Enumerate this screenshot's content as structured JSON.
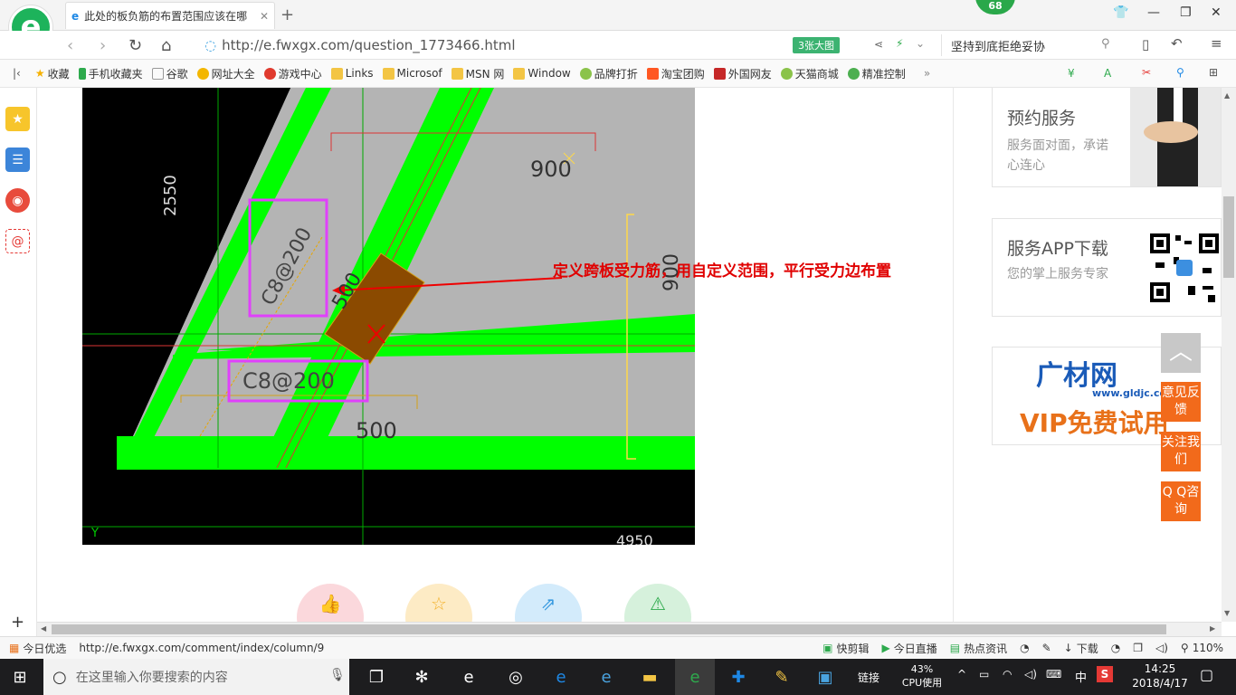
{
  "tab": {
    "title": "此处的板负筋的布置范围应该在哪"
  },
  "badge": "68",
  "address": {
    "url": "http://e.fwxgx.com/question_1773466.html",
    "bigpic": "3张大图"
  },
  "search": {
    "text": "坚持到底拒绝妥协"
  },
  "favorites": [
    "收藏",
    "手机收藏夹",
    "谷歌",
    "网址大全",
    "游戏中心",
    "Links",
    "Microsof",
    "MSN 网",
    "Window",
    "品牌打折",
    "淘宝团购",
    "外国网友",
    "天猫商城",
    "精准控制"
  ],
  "favorites_more": "»",
  "cad": {
    "dims": [
      "2550",
      "900",
      "900",
      "500",
      "500",
      "4950"
    ],
    "labels": [
      "C8@200",
      "C8@200"
    ],
    "axis": "Y"
  },
  "annotation": "定义跨板受力筋，用自定义范围，平行受力边布置",
  "cards": {
    "service": {
      "title": "预约服务",
      "sub": "服务面对面，承诺心连心"
    },
    "app": {
      "title": "服务APP下载",
      "sub": "您的掌上服务专家"
    },
    "ad": {
      "brand": "广材网",
      "url": "www.gldjc.com",
      "vip": "VIP免费试用"
    }
  },
  "float_buttons": [
    "意见反馈",
    "关注我们",
    "Q Q咨询"
  ],
  "status": {
    "left": [
      "今日优选"
    ],
    "url": "http://e.fwxgx.com/comment/index/column/9",
    "right": [
      "快剪辑",
      "今日直播",
      "热点资讯",
      "下载",
      "110%"
    ]
  },
  "taskbar": {
    "search_placeholder": "在这里输入你要搜索的内容",
    "link": "链接",
    "cpu_percent": "43%",
    "cpu_label": "CPU使用",
    "ime": "中",
    "time": "14:25",
    "date": "2018/4/17"
  }
}
